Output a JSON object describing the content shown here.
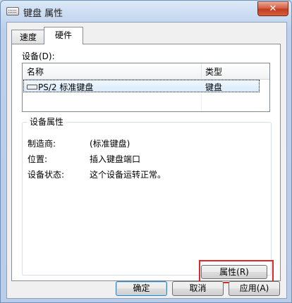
{
  "window": {
    "title": "键盘 属性",
    "close_glyph": "✕"
  },
  "tabs": [
    {
      "label": "速度"
    },
    {
      "label": "硬件"
    }
  ],
  "devices": {
    "label": "设备(D):",
    "columns": {
      "name": "名称",
      "type": "类型"
    },
    "rows": [
      {
        "name": "PS/2 标准键盘",
        "type": "键盘"
      }
    ]
  },
  "device_properties": {
    "title": "设备属性",
    "manufacturer_label": "制造商:",
    "manufacturer_value": "(标准键盘)",
    "location_label": "位置:",
    "location_value": "插入键盘端口",
    "status_label": "设备状态:",
    "status_value": "这个设备运转正常。",
    "properties_button": "属性(R)"
  },
  "buttons": {
    "ok": "确定",
    "cancel": "取消",
    "apply": "应用(A)"
  },
  "colors": {
    "highlight": "#e0262a",
    "close_button": "#c9452a"
  },
  "icons": {
    "app": "keyboard-icon",
    "row": "keyboard-icon"
  }
}
